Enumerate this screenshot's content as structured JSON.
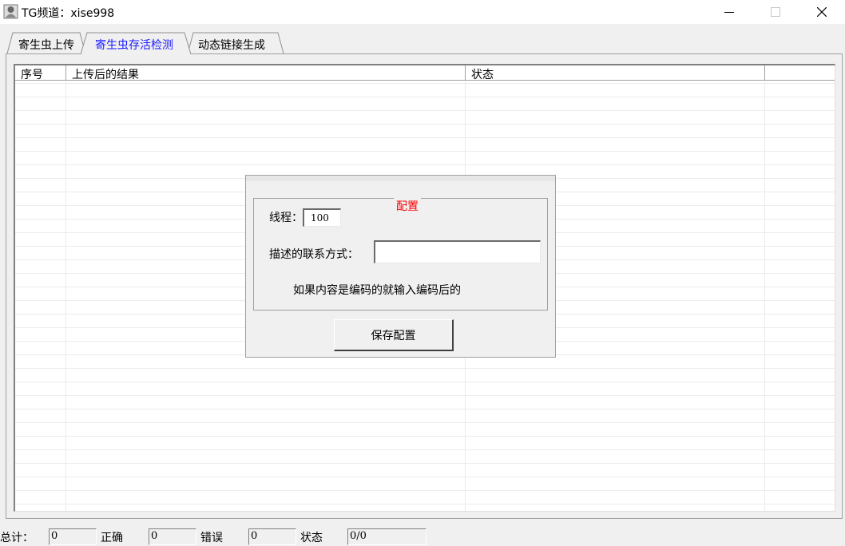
{
  "window": {
    "title": "TG频道：xise998",
    "controls": {
      "minimize_icon": "minimize-icon",
      "maximize_icon": "maximize-icon",
      "close_icon": "close-icon"
    }
  },
  "tabs": [
    {
      "label": "寄生虫上传",
      "active": false
    },
    {
      "label": "寄生虫存活检测",
      "active": true
    },
    {
      "label": "动态链接生成",
      "active": false
    }
  ],
  "table": {
    "columns": [
      "序号",
      "上传后的结果",
      "状态",
      ""
    ],
    "rows": []
  },
  "config": {
    "legend": "配置",
    "threads_label": "线程：",
    "threads_value": "100",
    "contact_label": "描述的联系方式：",
    "contact_value": "",
    "hint": "如果内容是编码的就输入编码后的",
    "save_label": "保存配置"
  },
  "status": {
    "total_label": "总计：",
    "total_value": "0",
    "correct_label": "正确",
    "correct_value": "0",
    "error_label": "错误",
    "error_value": "0",
    "state_label": "状态",
    "state_value": "0/0"
  },
  "colors": {
    "active_tab": "#1a1aff",
    "legend": "#ff0000"
  }
}
